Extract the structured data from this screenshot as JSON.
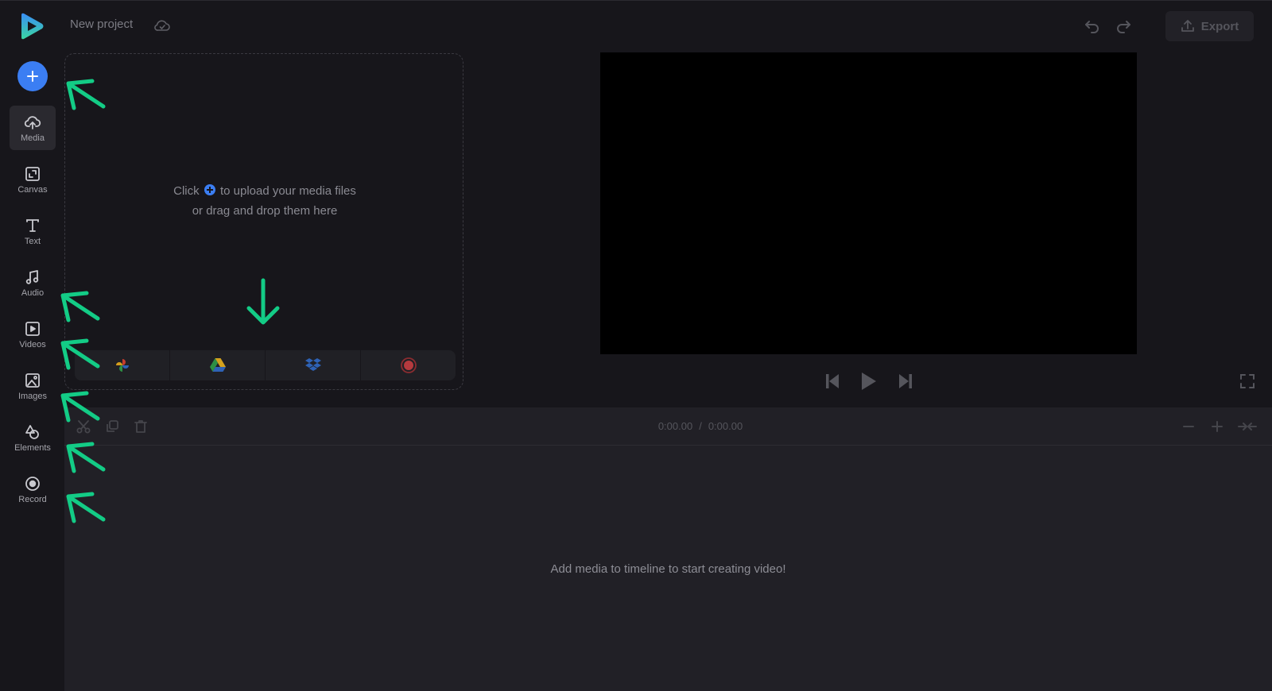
{
  "header": {
    "project_title": "New project",
    "export_label": "Export"
  },
  "sidebar": {
    "add_button": "add-media",
    "items": [
      {
        "label": "Media",
        "icon": "cloud-upload-icon",
        "active": true
      },
      {
        "label": "Canvas",
        "icon": "canvas-resize-icon",
        "active": false
      },
      {
        "label": "Text",
        "icon": "text-icon",
        "active": false
      },
      {
        "label": "Audio",
        "icon": "music-note-icon",
        "active": false
      },
      {
        "label": "Videos",
        "icon": "video-play-icon",
        "active": false
      },
      {
        "label": "Images",
        "icon": "image-icon",
        "active": false
      },
      {
        "label": "Elements",
        "icon": "shapes-icon",
        "active": false
      },
      {
        "label": "Record",
        "icon": "record-icon",
        "active": false
      }
    ]
  },
  "media_panel": {
    "drop_text_before": "Click",
    "drop_text_after": "to upload your media files",
    "drop_text_line2": "or drag and drop them here",
    "sources": [
      {
        "name": "Google Photos",
        "icon": "google-photos-icon"
      },
      {
        "name": "Google Drive",
        "icon": "google-drive-icon"
      },
      {
        "name": "Dropbox",
        "icon": "dropbox-icon"
      },
      {
        "name": "Record",
        "icon": "record-red-icon"
      }
    ]
  },
  "player": {
    "current_time": "0:00.00",
    "separator": "/",
    "total_time": "0:00.00"
  },
  "timeline": {
    "empty_message": "Add media to timeline to start creating video!"
  },
  "colors": {
    "accent": "#3b7ef3",
    "annotation": "#13cc86",
    "background": "#17161b",
    "timeline_bg": "#212026"
  }
}
